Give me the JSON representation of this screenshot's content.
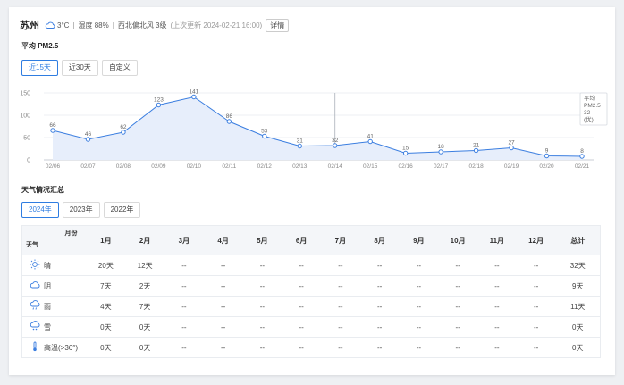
{
  "header": {
    "city": "苏州",
    "weather_icon": "cloud-icon",
    "temp": "3°C",
    "humidity": "湿度 88%",
    "wind": "西北偏北风 3级",
    "updated": "(上次更新 2024-02-21 16:00)",
    "detail_btn": "详情"
  },
  "pm_title": "平均 PM2.5",
  "range_tabs": [
    "近15天",
    "近30天",
    "自定义"
  ],
  "active_range_tab": 0,
  "chart_data": {
    "type": "area",
    "x": [
      "02/06",
      "02/07",
      "02/08",
      "02/09",
      "02/10",
      "02/11",
      "02/12",
      "02/13",
      "02/14",
      "02/15",
      "02/16",
      "02/17",
      "02/18",
      "02/19",
      "02/20",
      "02/21"
    ],
    "values": [
      66,
      46,
      62,
      123,
      141,
      86,
      53,
      31,
      32,
      41,
      15,
      18,
      21,
      27,
      9,
      8
    ],
    "ylim": [
      0,
      150
    ],
    "yticks": [
      0,
      50,
      100,
      150
    ],
    "grid": true,
    "hover_index": 8,
    "color": "#3b7ee0",
    "tooltip": {
      "line1": "平均",
      "line2": "PM2.5",
      "value": "32",
      "unit": "(优)"
    }
  },
  "summary_title": "天气情况汇总",
  "year_tabs": [
    "2024年",
    "2023年",
    "2022年"
  ],
  "active_year_tab": 0,
  "table": {
    "corner_month": "月份",
    "corner_weather": "天气",
    "months": [
      "1月",
      "2月",
      "3月",
      "4月",
      "5月",
      "6月",
      "7月",
      "8月",
      "9月",
      "10月",
      "11月",
      "12月"
    ],
    "total_label": "总计",
    "rows": [
      {
        "icon": "sun-icon",
        "label": "晴",
        "values": [
          "20天",
          "12天",
          "--",
          "--",
          "--",
          "--",
          "--",
          "--",
          "--",
          "--",
          "--",
          "--"
        ],
        "total": "32天"
      },
      {
        "icon": "cloud-icon",
        "label": "阴",
        "values": [
          "7天",
          "2天",
          "--",
          "--",
          "--",
          "--",
          "--",
          "--",
          "--",
          "--",
          "--",
          "--"
        ],
        "total": "9天"
      },
      {
        "icon": "rain-icon",
        "label": "雨",
        "values": [
          "4天",
          "7天",
          "--",
          "--",
          "--",
          "--",
          "--",
          "--",
          "--",
          "--",
          "--",
          "--"
        ],
        "total": "11天"
      },
      {
        "icon": "snow-icon",
        "label": "雪",
        "values": [
          "0天",
          "0天",
          "--",
          "--",
          "--",
          "--",
          "--",
          "--",
          "--",
          "--",
          "--",
          "--"
        ],
        "total": "0天"
      },
      {
        "icon": "thermometer-icon",
        "label": "高温(>36°)",
        "values": [
          "0天",
          "0天",
          "--",
          "--",
          "--",
          "--",
          "--",
          "--",
          "--",
          "--",
          "--",
          "--"
        ],
        "total": "0天"
      }
    ]
  }
}
